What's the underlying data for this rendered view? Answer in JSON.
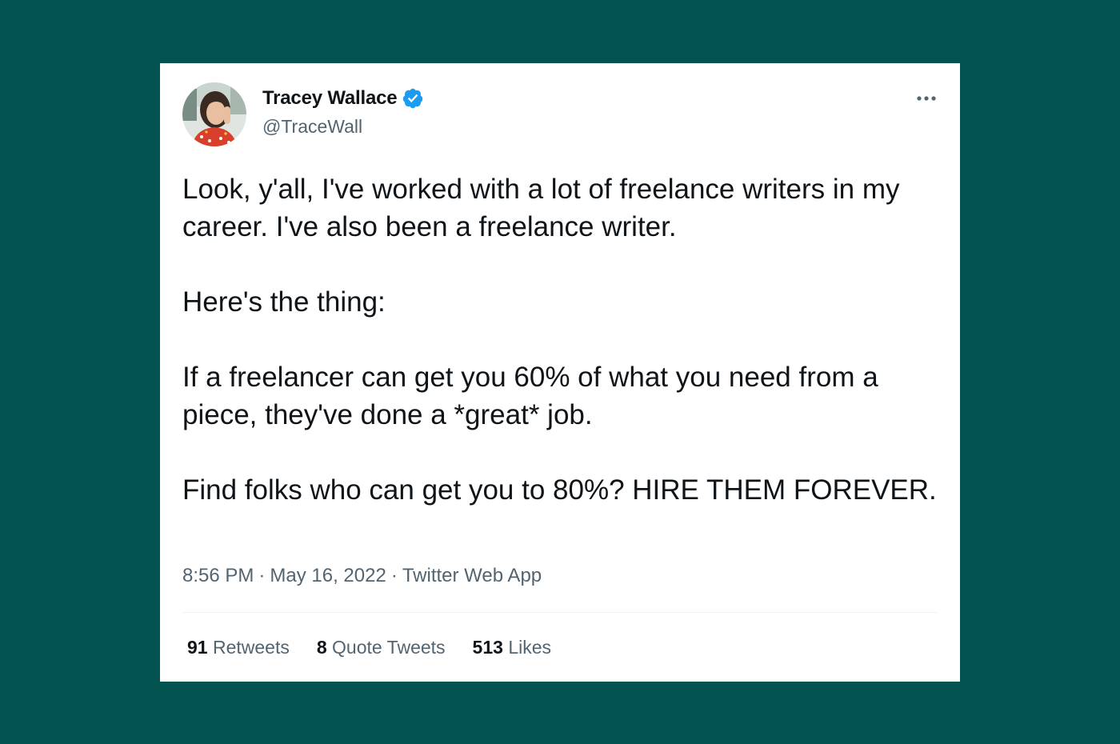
{
  "author": {
    "name": "Tracey Wallace",
    "handle": "@TraceWall",
    "verified": true
  },
  "tweet": {
    "paragraphs": [
      "Look, y'all, I've worked with a lot of freelance writers in my career. I've also been a freelance writer.",
      "Here's the thing:",
      "If a freelancer can get you 60% of what you need from a piece, they've done a *great* job.",
      "Find folks who can get you to 80%? HIRE THEM FOREVER."
    ]
  },
  "meta": {
    "time": "8:56 PM",
    "date": "May 16, 2022",
    "source": "Twitter Web App",
    "separator": "·"
  },
  "stats": {
    "retweets_count": "91",
    "retweets_label": "Retweets",
    "quotes_count": "8",
    "quotes_label": "Quote Tweets",
    "likes_count": "513",
    "likes_label": "Likes"
  },
  "icons": {
    "verified": "verified-badge-icon",
    "more": "more-options-icon"
  },
  "colors": {
    "background": "#035451",
    "card": "#ffffff",
    "text": "#0f1419",
    "muted": "#536471",
    "verified": "#1d9bf0"
  }
}
